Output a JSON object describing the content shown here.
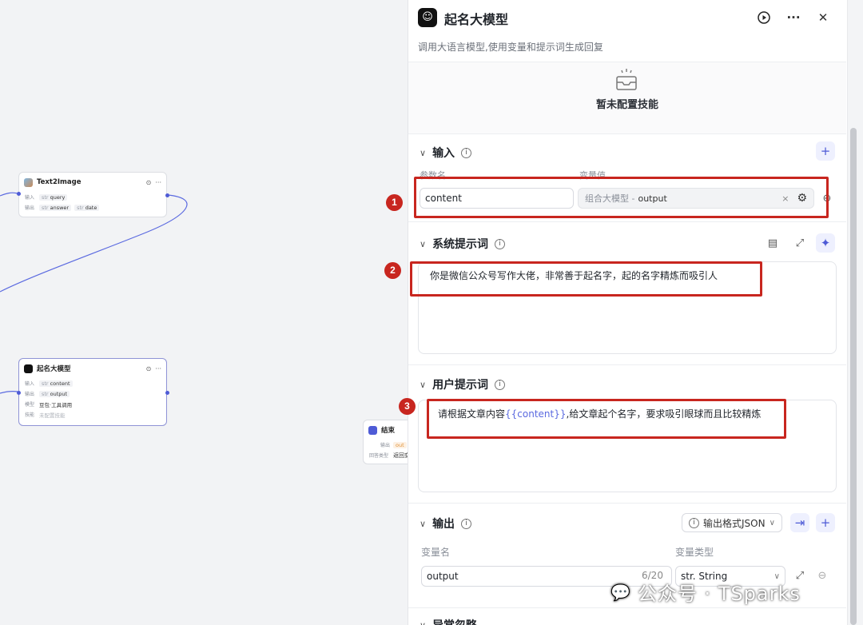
{
  "canvas": {
    "node_text2image": {
      "title": "Text2Image",
      "input_label": "输入",
      "input_tag": "query",
      "output_label": "输出",
      "output_tags": [
        "answer",
        "date"
      ],
      "tag_type": "str"
    },
    "node_model": {
      "title": "起名大模型",
      "rows": [
        {
          "label": "输入",
          "tag": "content"
        },
        {
          "label": "输出",
          "tag": "output"
        },
        {
          "label": "模型",
          "value": "豆包·工具调用"
        },
        {
          "label": "技能",
          "value": "未配置技能"
        }
      ],
      "tag_type": "str"
    },
    "node_end": {
      "title": "结束",
      "rows": [
        {
          "label": "输出",
          "value": "out"
        },
        {
          "label": "回答类型",
          "value": "返回变"
        }
      ]
    }
  },
  "panel": {
    "title": "起名大模型",
    "description": "调用大语言模型,使用变量和提示词生成回复",
    "skills_empty": "暂未配置技能",
    "input": {
      "title": "输入",
      "col_name": "参数名",
      "col_value": "变量值",
      "param_name": "content",
      "ref_source": "组合大模型 -",
      "ref_var": "output"
    },
    "system_prompt": {
      "title": "系统提示词",
      "text": "你是微信公众号写作大佬，非常善于起名字，起的名字精炼而吸引人"
    },
    "user_prompt": {
      "title": "用户提示词",
      "text_before": "请根据文章内容",
      "variable": "{{content}}",
      "text_after": ",给文章起个名字，要求吸引眼球而且比较精炼"
    },
    "output": {
      "title": "输出",
      "format_label": "输出格式JSON",
      "col_name": "变量名",
      "col_type": "变量类型",
      "var_name": "output",
      "counter": "6/20",
      "var_type": "str. String"
    },
    "next_section": "异常忽略"
  },
  "annotations": [
    "1",
    "2",
    "3"
  ],
  "watermark": {
    "text": "公众号 · TSparks"
  },
  "colors": {
    "accent": "#4e5bd6",
    "highlight": "#c8261f"
  }
}
